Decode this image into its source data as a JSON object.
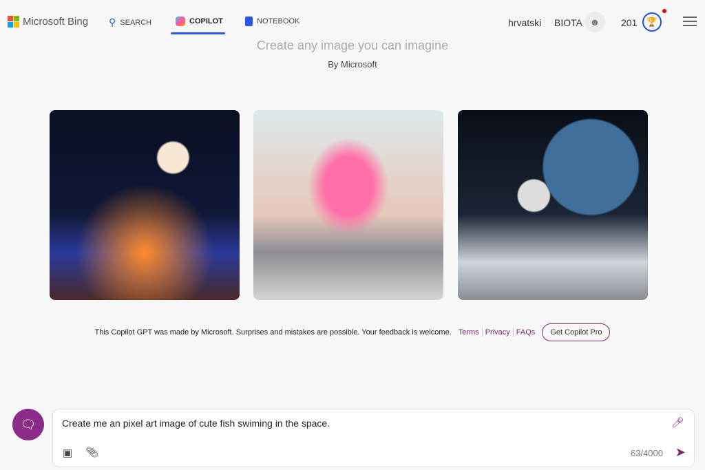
{
  "header": {
    "brand": "Microsoft Bing",
    "nav": [
      {
        "label": "SEARCH",
        "icon": "search-icon"
      },
      {
        "label": "COPILOT",
        "icon": "copilot-icon",
        "active": true
      },
      {
        "label": "NOTEBOOK",
        "icon": "notebook-icon"
      }
    ],
    "language": "hrvatski",
    "username": "BIOTA",
    "points": "201",
    "accent": "#2a56e6"
  },
  "main": {
    "title": "Create any image you can imagine",
    "byline": "By Microsoft",
    "images": [
      {
        "alt": "lanterns fantasy"
      },
      {
        "alt": "flamingos"
      },
      {
        "alt": "astronaut skiing"
      }
    ]
  },
  "footer": {
    "disclaimer": "This Copilot GPT was made by Microsoft. Surprises and mistakes are possible. Your feedback is welcome.",
    "links": [
      "Terms",
      "Privacy",
      "FAQs"
    ],
    "pro_button": "Get Copilot Pro"
  },
  "composer": {
    "value": "Create me an pixel art image of cute fish swiming in the space.",
    "counter": "63/4000",
    "accent": "#8b2c88"
  }
}
